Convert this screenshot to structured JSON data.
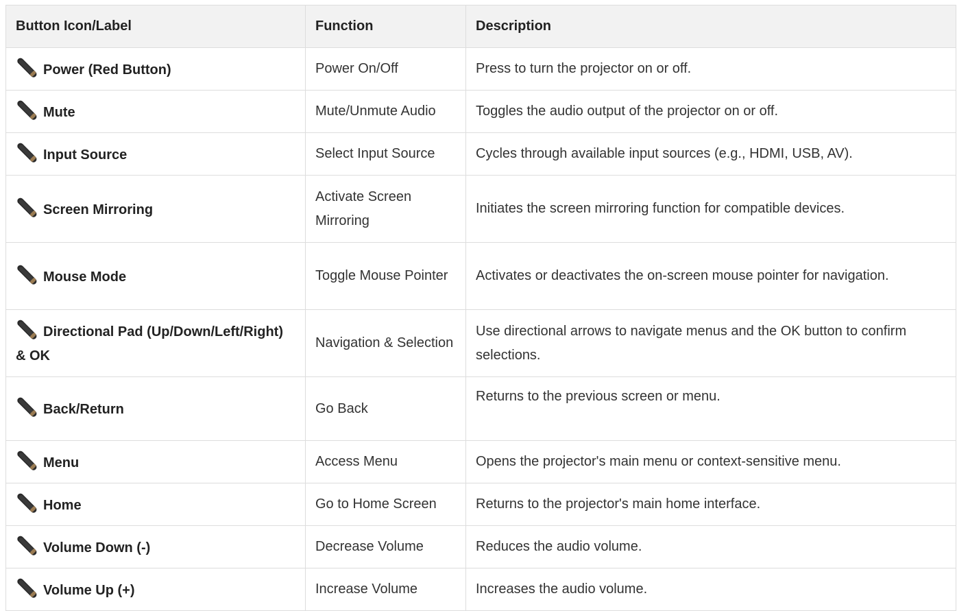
{
  "headers": {
    "button": "Button Icon/Label",
    "function": "Function",
    "description": "Description"
  },
  "rows": [
    {
      "label": "Power (Red Button)",
      "function": "Power On/Off",
      "description": "Press to turn the projector on or off."
    },
    {
      "label": "Mute",
      "function": "Mute/Unmute Audio",
      "description": "Toggles the audio output of the projector on or off."
    },
    {
      "label": "Input Source",
      "function": "Select Input Source",
      "description": "Cycles through available input sources (e.g., HDMI, USB, AV)."
    },
    {
      "label": "Screen Mirroring",
      "function": "Activate Screen Mirroring",
      "description": "Initiates the screen mirroring function for compatible devices."
    },
    {
      "label": "Mouse Mode",
      "function": "Toggle Mouse Pointer",
      "description": "Activates or deactivates the on-screen mouse pointer for navigation."
    },
    {
      "label": "Directional Pad (Up/Down/Left/Right) & OK",
      "function": "Navigation & Selection",
      "description": "Use directional arrows to navigate menus and the OK button to confirm selections."
    },
    {
      "label": "Back/Return",
      "function": "Go Back",
      "description": "Returns to the previous screen or menu."
    },
    {
      "label": "Menu",
      "function": "Access Menu",
      "description": "Opens the projector's main menu or context-sensitive menu."
    },
    {
      "label": "Home",
      "function": "Go to Home Screen",
      "description": "Returns to the projector's main home interface."
    },
    {
      "label": "Volume Down (-)",
      "function": "Decrease Volume",
      "description": "Reduces the audio volume."
    },
    {
      "label": "Volume Up (+)",
      "function": "Increase Volume",
      "description": "Increases the audio volume."
    }
  ],
  "icon": "remote-control-icon"
}
